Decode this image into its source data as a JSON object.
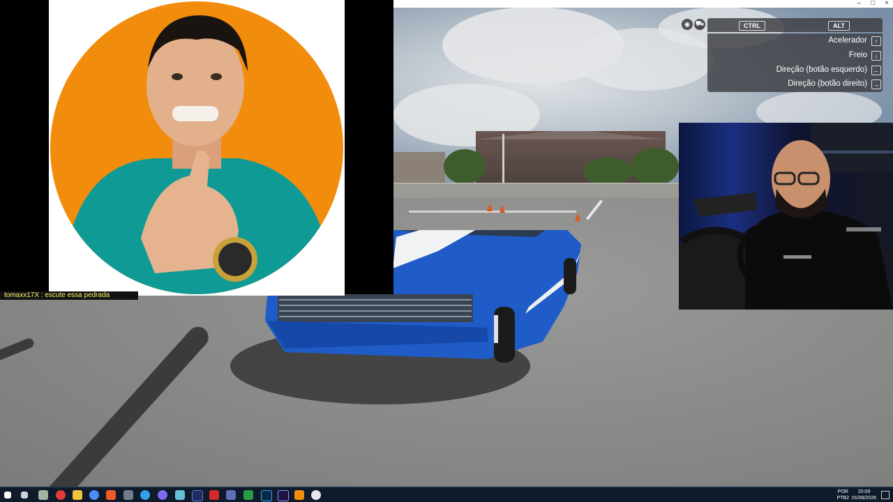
{
  "window_controls": {
    "minimize": "–",
    "maximize": "□",
    "close": "×"
  },
  "chat": {
    "message": "tomaxx17X : escute essa pedrada"
  },
  "hint_bar": {
    "view_icon": "eye-icon",
    "car_icon": "car-icon",
    "key_left": "CTRL",
    "key_right": "ALT"
  },
  "controls": [
    {
      "label": "Acelerador",
      "key": "↑",
      "icon": "arrow-up-icon"
    },
    {
      "label": "Freio",
      "key": "↓",
      "icon": "arrow-down-icon"
    },
    {
      "label": "Direção (botão esquerdo)",
      "key": "←",
      "icon": "arrow-left-icon"
    },
    {
      "label": "Direção (botão direito)",
      "key": "→",
      "icon": "arrow-right-icon"
    }
  ],
  "taskbar": {
    "lang_line1": "POR",
    "lang_line2": "PTB2",
    "time": "20:09",
    "date": "01/08/2026",
    "icons": [
      "start-icon",
      "task-view-icon",
      "app-icon",
      "app-icon",
      "file-explorer-icon",
      "chrome-icon",
      "brave-icon",
      "app-icon",
      "app-icon",
      "app-icon",
      "app-icon",
      "audition-icon",
      "app-icon",
      "app-icon",
      "app-icon",
      "photoshop-icon",
      "premiere-icon",
      "app-icon",
      "app-icon"
    ],
    "colors": {
      "bar": "#0f1a2a",
      "accent": "#f28c0c"
    }
  }
}
